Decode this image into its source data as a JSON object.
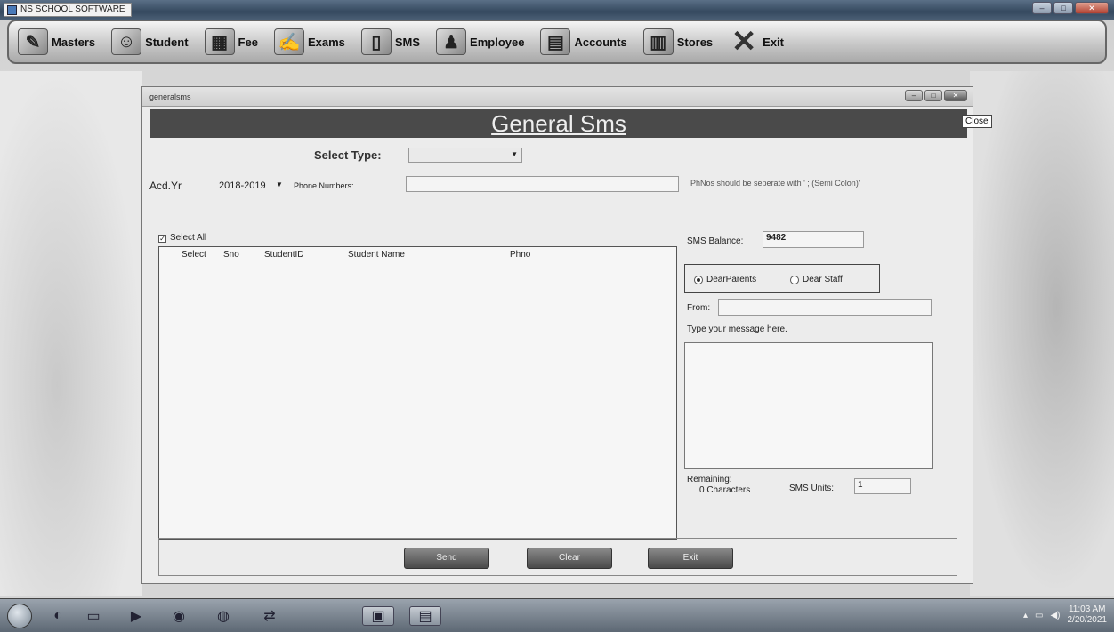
{
  "app": {
    "title": "NS SCHOOL SOFTWARE"
  },
  "menu": [
    {
      "label": "Masters",
      "icon": "masters-icon",
      "glyph": "✎"
    },
    {
      "label": "Student",
      "icon": "students-icon",
      "glyph": "☺"
    },
    {
      "label": "Fee",
      "icon": "fee-chart-icon",
      "glyph": "▦"
    },
    {
      "label": "Exams",
      "icon": "exams-icon",
      "glyph": "✍"
    },
    {
      "label": "SMS",
      "icon": "sms-icon",
      "glyph": "▯"
    },
    {
      "label": "Employee",
      "icon": "employee-icon",
      "glyph": "♟"
    },
    {
      "label": "Accounts",
      "icon": "accounts-icon",
      "glyph": "▤"
    },
    {
      "label": "Stores",
      "icon": "stores-icon",
      "glyph": "▥"
    },
    {
      "label": "Exit",
      "icon": "exit-icon",
      "glyph": "✕"
    }
  ],
  "window": {
    "title": "generalsms",
    "tooltip": "Close",
    "header": "General Sms"
  },
  "form": {
    "select_type_label": "Select Type:",
    "select_type_value": "",
    "acd_yr_label": "Acd.Yr",
    "acd_yr_value": "2018-2019",
    "phone_numbers_label": "Phone Numbers:",
    "phone_numbers_value": "",
    "phone_hint": "PhNos should be seperate with ' ; (Semi Colon)'",
    "select_all_label": "Select All",
    "select_all_checked": true
  },
  "grid": {
    "columns": [
      "Select",
      "Sno",
      "StudentID",
      "Student Name",
      "Phno"
    ],
    "rows": []
  },
  "sms": {
    "balance_label": "SMS Balance:",
    "balance_value": "9482",
    "greeting_options": [
      "DearParents",
      "Dear Staff"
    ],
    "greeting_selected": "DearParents",
    "from_label": "From:",
    "from_value": "",
    "message_label": "Type your message here.",
    "message_value": "",
    "remaining_label": "Remaining:",
    "remaining_value": "0 Characters",
    "units_label": "SMS Units:",
    "units_value": "1"
  },
  "buttons": {
    "send": "Send",
    "clear": "Clear",
    "exit": "Exit"
  },
  "taskbar": {
    "time": "11:03 AM",
    "date": "2/20/2021"
  }
}
